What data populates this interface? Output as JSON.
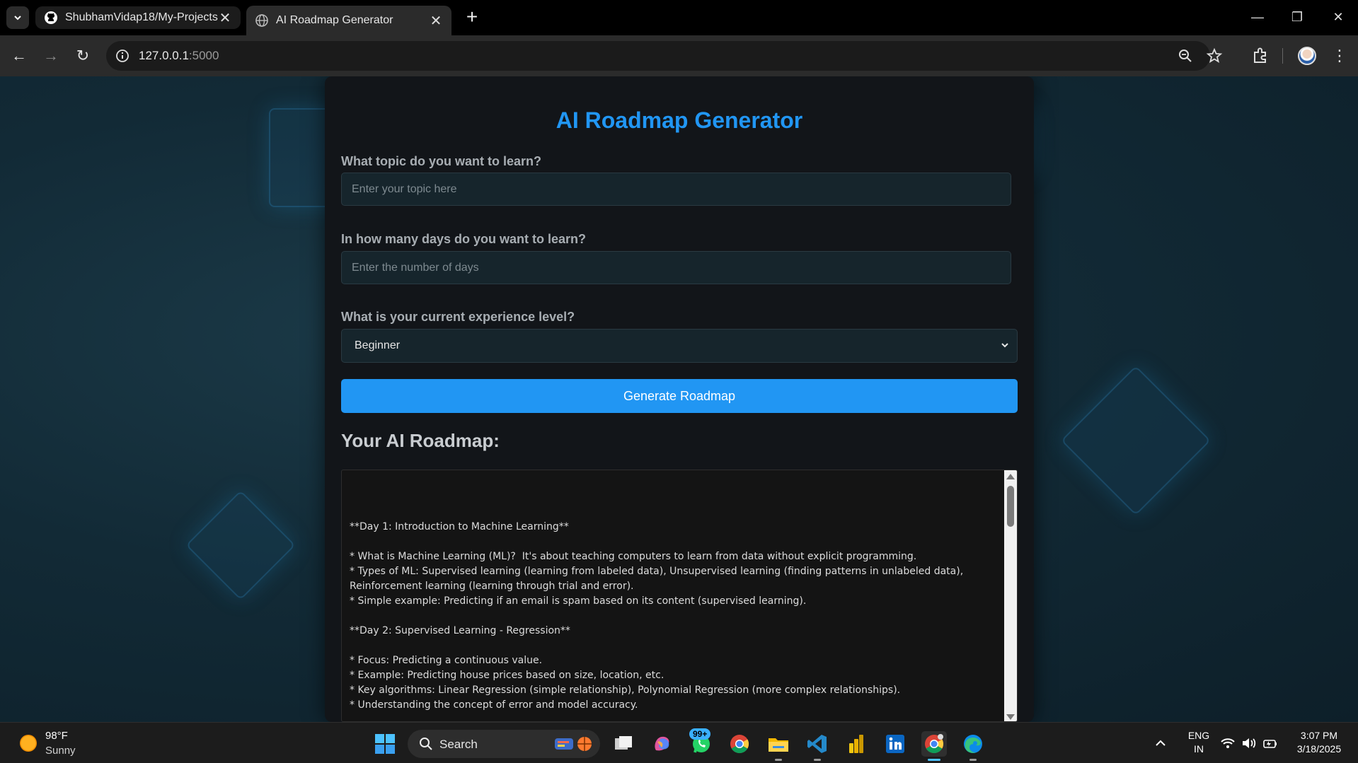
{
  "browser": {
    "tabs": [
      {
        "title": "ShubhamVidap18/My-Projects:",
        "active": false,
        "icon": "github-icon"
      },
      {
        "title": "AI Roadmap Generator",
        "active": true,
        "icon": "globe-icon"
      }
    ],
    "address": {
      "host": "127.0.0.1",
      "port": ":5000"
    }
  },
  "app": {
    "title": "AI Roadmap Generator",
    "topic": {
      "label": "What topic do you want to learn?",
      "placeholder": "Enter your topic here"
    },
    "days": {
      "label": "In how many days do you want to learn?",
      "placeholder": "Enter the number of days"
    },
    "experience": {
      "label": "What is your current experience level?",
      "selected": "Beginner"
    },
    "generate_label": "Generate Roadmap",
    "result_heading": "Your AI Roadmap:",
    "result_text": "**Day 1: Introduction to Machine Learning**\n\n* What is Machine Learning (ML)?  It's about teaching computers to learn from data without explicit programming.\n* Types of ML: Supervised learning (learning from labeled data), Unsupervised learning (finding patterns in unlabeled data), Reinforcement learning (learning through trial and error).\n* Simple example: Predicting if an email is spam based on its content (supervised learning).\n\n**Day 2: Supervised Learning - Regression**\n\n* Focus: Predicting a continuous value.\n* Example: Predicting house prices based on size, location, etc.\n* Key algorithms: Linear Regression (simple relationship), Polynomial Regression (more complex relationships).\n* Understanding the concept of error and model accuracy."
  },
  "taskbar": {
    "weather": {
      "temp": "98°F",
      "condition": "Sunny"
    },
    "search_label": "Search",
    "whatsapp_badge": "99+",
    "language": {
      "line1": "ENG",
      "line2": "IN"
    },
    "clock": {
      "time": "3:07 PM",
      "date": "3/18/2025"
    }
  },
  "colors": {
    "accent": "#2196f3",
    "card": "#121519",
    "input": "#16252c"
  }
}
